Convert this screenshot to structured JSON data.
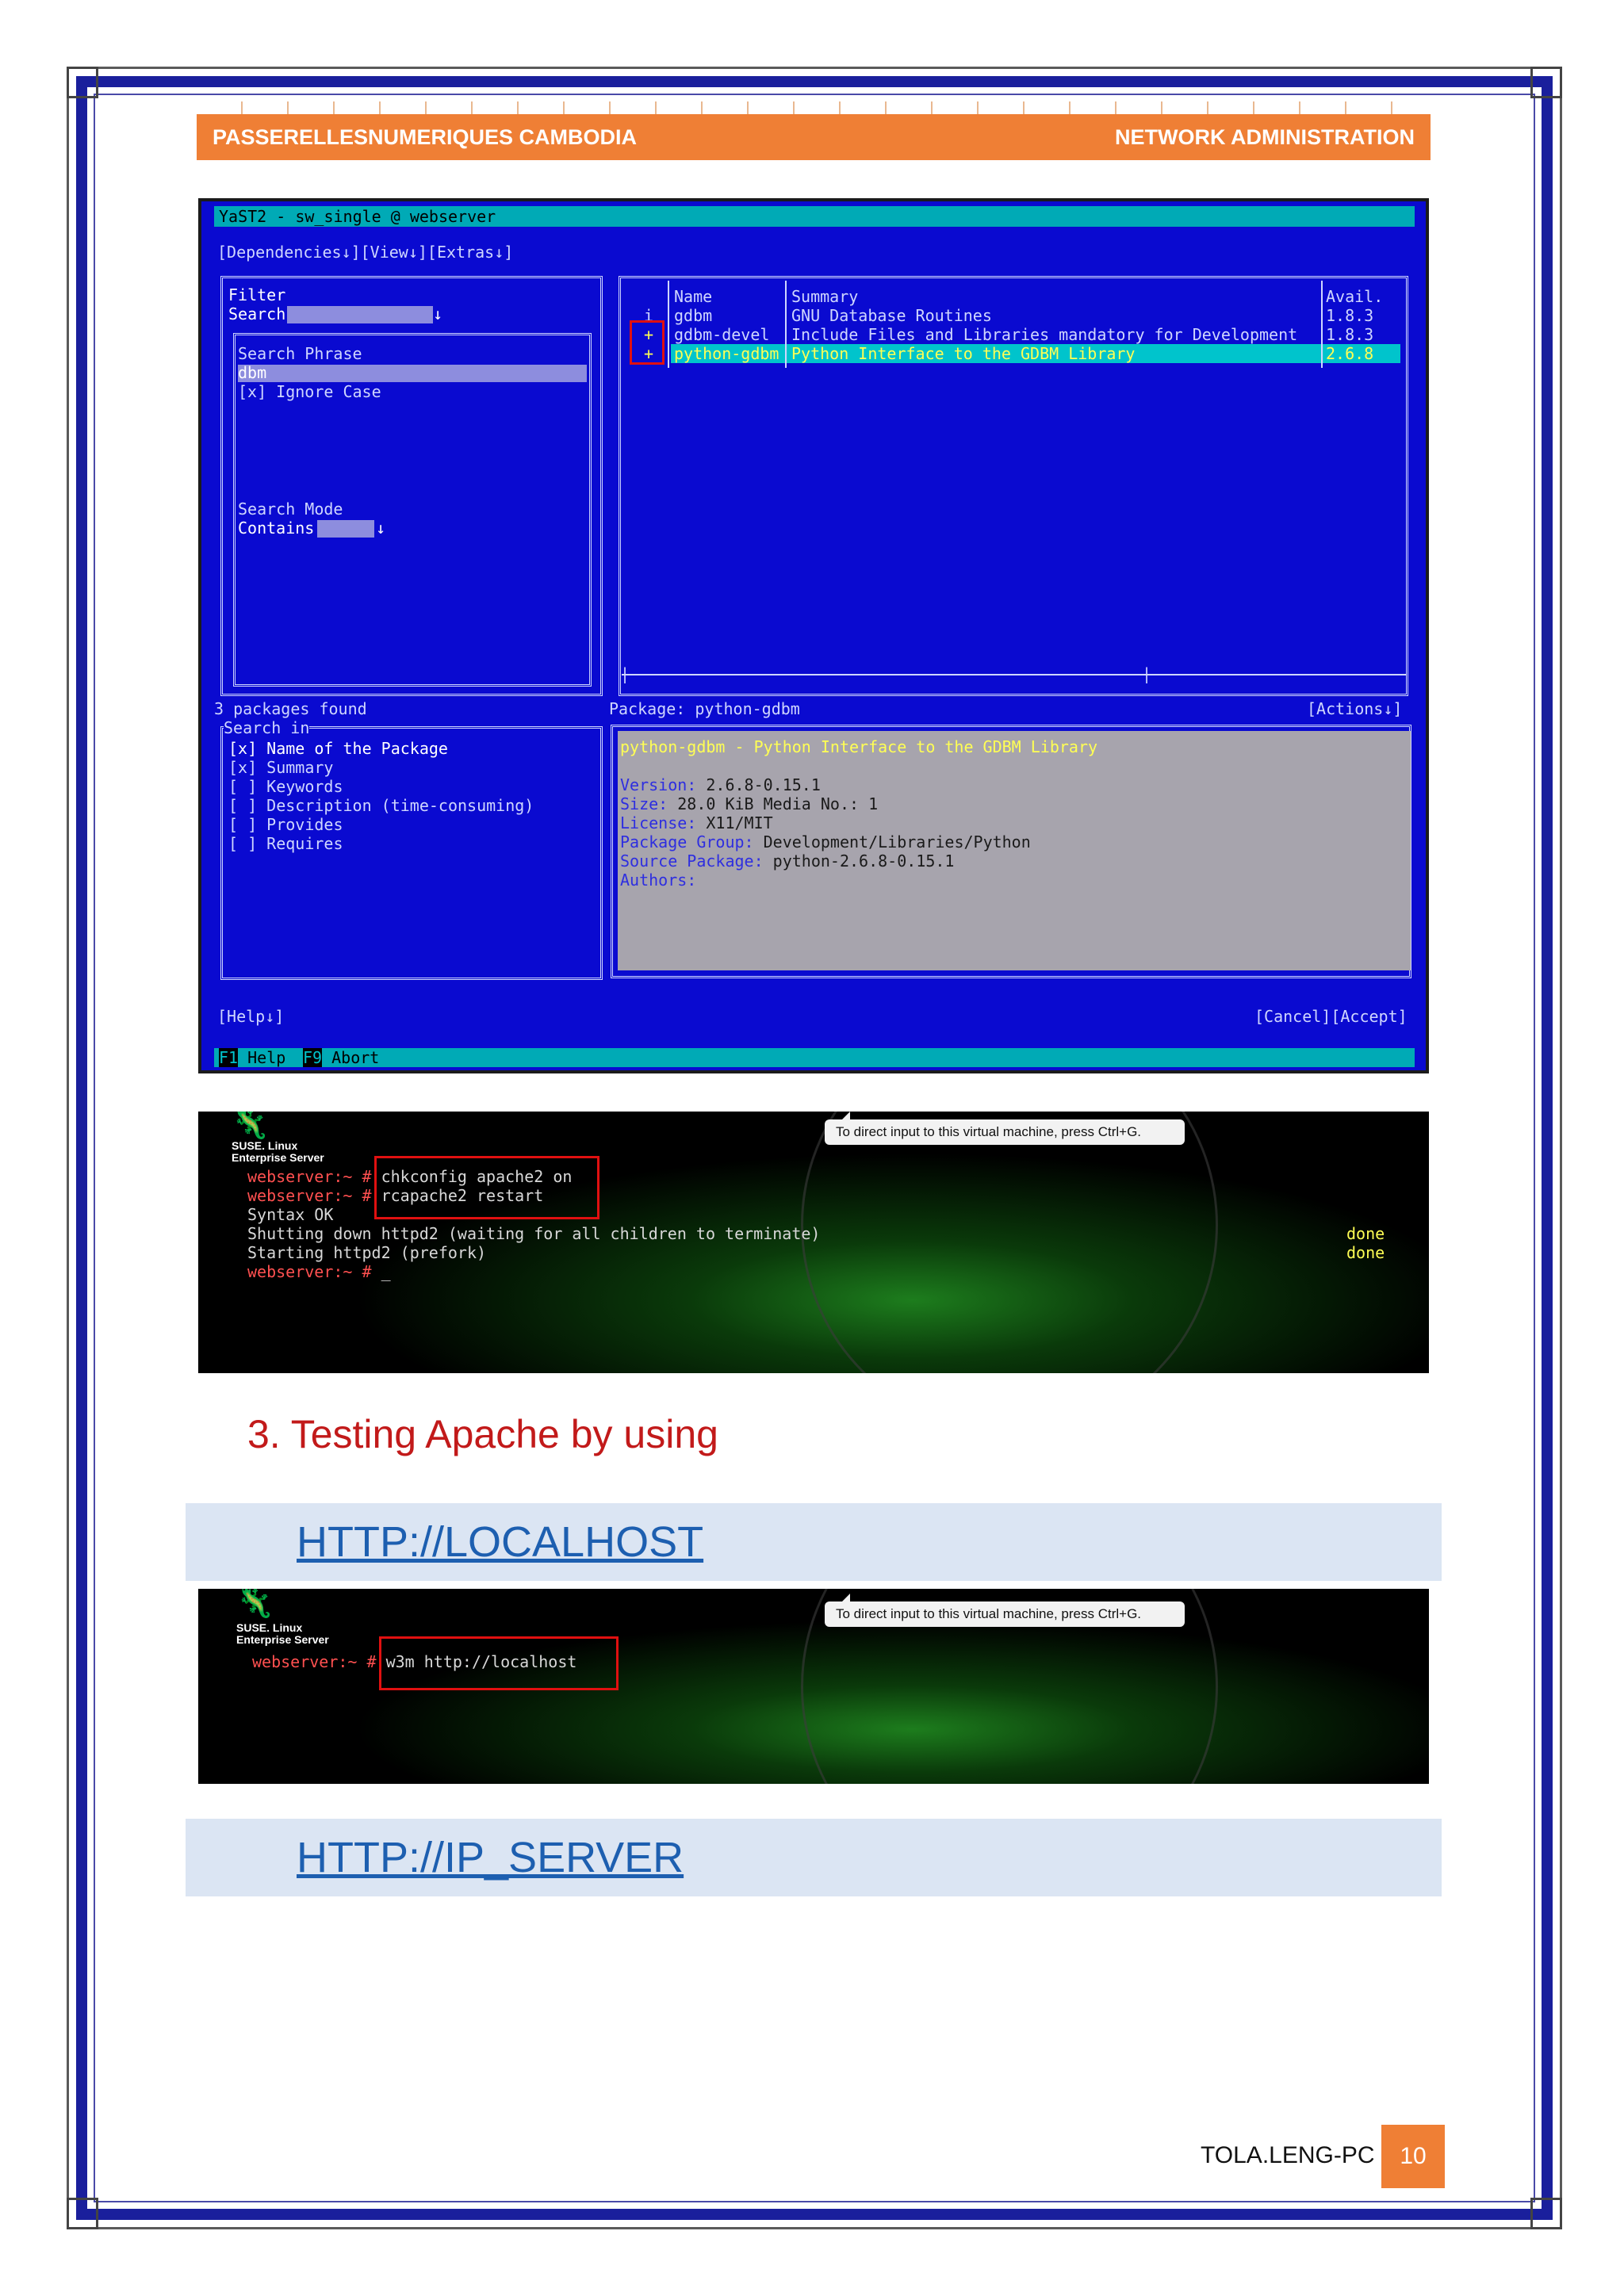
{
  "header": {
    "left": "PASSERELLESNUMERIQUES CAMBODIA",
    "right": "NETWORK ADMINISTRATION"
  },
  "yast": {
    "title": "YaST2 - sw_single @ webserver",
    "menu": "[Dependencies↓][View↓][Extras↓]",
    "filter_label": "Filter",
    "filter_value": "Search",
    "search_phrase_label": "Search Phrase",
    "search_phrase_value": "dbm",
    "ignore_case": "[x] Ignore Case",
    "search_mode_label": "Search Mode",
    "search_mode_value": "Contains",
    "columns": [
      "Name",
      "Summary",
      "Avail."
    ],
    "packages": [
      {
        "status": "i",
        "name": "gdbm",
        "summary": "GNU Database Routines",
        "avail": "1.8.3"
      },
      {
        "status": "+",
        "name": "gdbm-devel",
        "summary": "Include Files and Libraries mandatory for Development",
        "avail": "1.8.3"
      },
      {
        "status": "+",
        "name": "python-gdbm",
        "summary": "Python Interface to the GDBM Library",
        "avail": "2.6.8"
      }
    ],
    "packages_found": "3 packages found",
    "search_in_label": "Search in",
    "search_in": [
      "[x] Name of the Package",
      "[x] Summary",
      "[ ] Keywords",
      "[ ] Description (time-consuming)",
      "[ ] Provides",
      "[ ] Requires"
    ],
    "package_label": "Package: python-gdbm",
    "actions": "[Actions↓]",
    "info_title": "python-gdbm - Python Interface to the GDBM Library",
    "info_lines": [
      {
        "k": "Version:",
        "v": " 2.6.8-0.15.1"
      },
      {
        "k": "Size:",
        "v": " 28.0 KiB Media No.: 1"
      },
      {
        "k": "License:",
        "v": " X11/MIT"
      },
      {
        "k": "Package Group:",
        "v": " Development/Libraries/Python"
      },
      {
        "k": "Source Package:",
        "v": " python-2.6.8-0.15.1"
      },
      {
        "k": "Authors:",
        "v": ""
      }
    ],
    "help": "[Help↓]",
    "cancel_accept": "[Cancel][Accept]",
    "f1": "F1",
    "f1_label": "Help",
    "f9": "F9",
    "f9_label": "Abort"
  },
  "terminal1": {
    "tooltip": "To direct input to this virtual machine, press Ctrl+G.",
    "logo": [
      "SUSE. Linux",
      "Enterprise Server"
    ],
    "lines": [
      {
        "prompt": "webserver:~ #",
        "cmd": " chkconfig apache2 on"
      },
      {
        "prompt": "webserver:~ #",
        "cmd": " rcapache2 restart"
      },
      {
        "prompt": "",
        "cmd": "Syntax OK"
      },
      {
        "prompt": "",
        "cmd": "Shutting down httpd2 (waiting for all children to terminate)"
      },
      {
        "prompt": "",
        "cmd": "Starting httpd2 (prefork)"
      },
      {
        "prompt": "webserver:~ #",
        "cmd": " _"
      }
    ],
    "done": [
      "done",
      "done"
    ]
  },
  "heading": "3.  Testing Apache by using",
  "link1": "HTTP://LOCALHOST",
  "terminal2": {
    "tooltip": "To direct input to this virtual machine, press Ctrl+G.",
    "logo": [
      "SUSE. Linux",
      "Enterprise Server"
    ],
    "prompt": "webserver:~ #",
    "cmd": " w3m http://localhost"
  },
  "link2": "HTTP://IP_SERVER",
  "footer": {
    "author": "TOLA.LENG-PC",
    "page": "10"
  }
}
